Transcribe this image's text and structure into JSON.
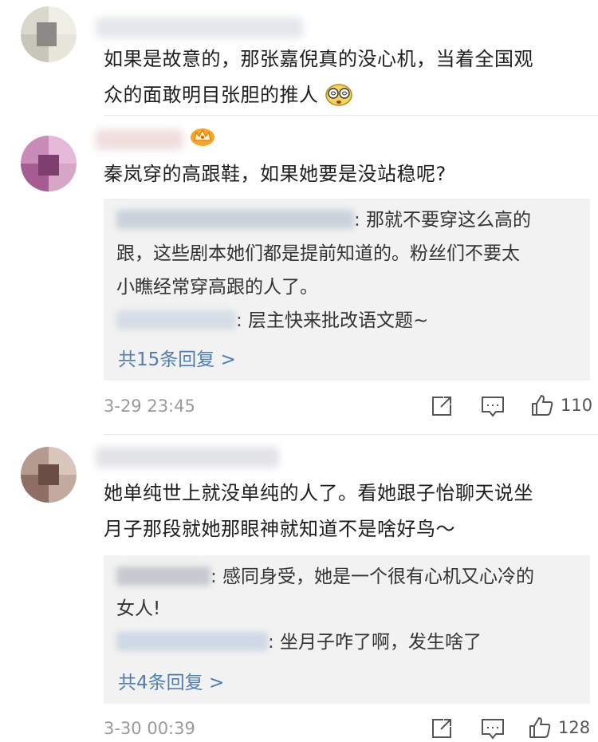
{
  "comments": [
    {
      "content_lines": [
        "如果是故意的，那张嘉倪真的没心机，当着全国观",
        "众的面敢明目张胆的推人"
      ],
      "emoji": "dizzy-face-emoji"
    },
    {
      "content": "秦岚穿的高跟鞋，如果她要是没站稳呢?",
      "badge": "crown-badge",
      "replies": [
        {
          "lines": [
            ": 那就不要穿这么高的",
            "跟，这些剧本她们都是提前知道的。粉丝们不要太",
            "小瞧经常穿高跟的人了。"
          ]
        },
        {
          "lines": [
            ": 层主快来批改语文题~"
          ]
        }
      ],
      "more_replies": "共15条回复 >",
      "time": "3-29 23:45",
      "likes": "110"
    },
    {
      "content_lines": [
        "她单纯世上就没单纯的人了。看她跟子怡聊天说坐",
        "月子那段就她那眼神就知道不是啥好鸟～"
      ],
      "replies": [
        {
          "lines": [
            ": 感同身受，她是一个很有心机又心冷的",
            "女人!"
          ]
        },
        {
          "lines": [
            ": 坐月子咋了啊，发生啥了"
          ]
        }
      ],
      "more_replies": "共4条回复 >",
      "time": "3-30 00:39",
      "likes": "128"
    }
  ],
  "colors": {
    "link": "#4f7db3",
    "reply_bg": "#f2f2f2",
    "meta": "#9a9a9a"
  }
}
